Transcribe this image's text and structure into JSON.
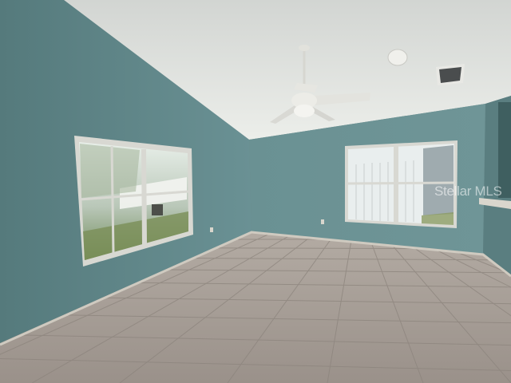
{
  "watermark": {
    "text": "Stellar MLS"
  },
  "colors": {
    "ceiling": "#e4e6e2",
    "wall_left": "#5f8687",
    "wall_back": "#6a9194",
    "wall_right": "#5a7e80",
    "floor": "#a49b93",
    "grout": "#8a827b",
    "baseboard": "#cfcac0",
    "window_frame": "#d8d8d2",
    "fan": "#dcdcd6"
  },
  "scene": {
    "subjects": [
      "vaulted-ceiling",
      "ceiling-fan",
      "left-window",
      "back-window",
      "tile-floor",
      "air-vent"
    ]
  }
}
